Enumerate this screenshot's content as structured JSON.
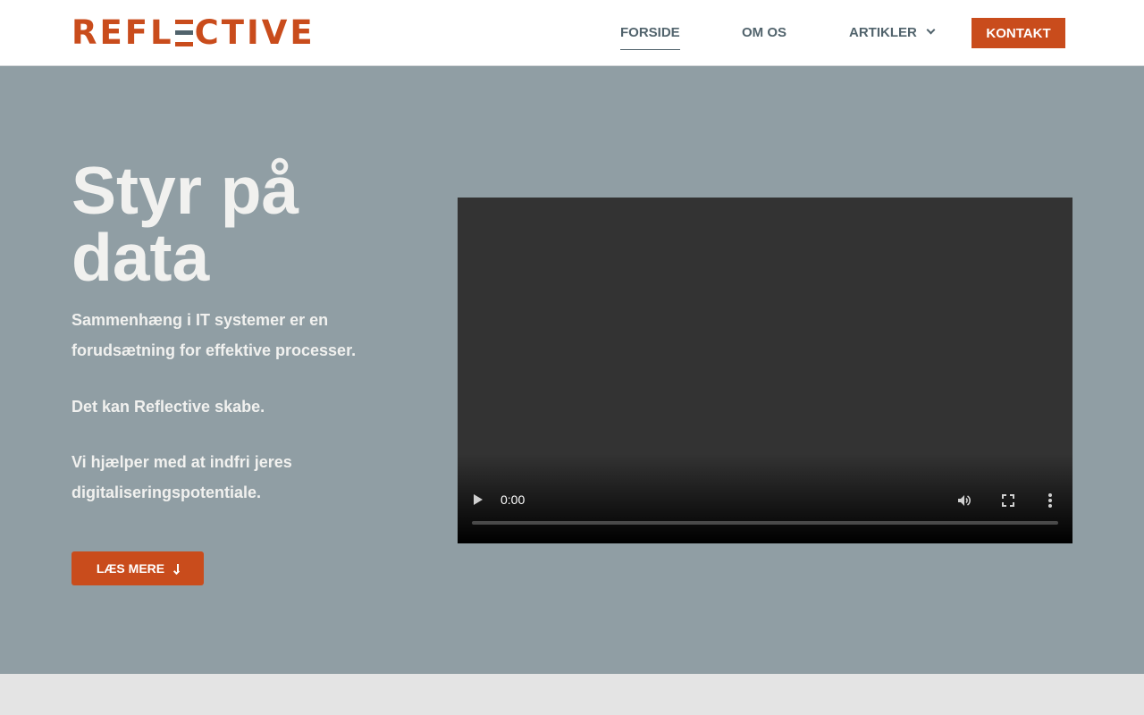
{
  "brand": {
    "logo_text_left": "REFL",
    "logo_text_right": "CTIVE",
    "color": "#c94c1c"
  },
  "nav": {
    "items": [
      {
        "label": "FORSIDE",
        "active": true
      },
      {
        "label": "OM OS",
        "active": false
      },
      {
        "label": "ARTIKLER",
        "active": false,
        "has_dropdown": true
      }
    ],
    "contact_label": "KONTAKT"
  },
  "hero": {
    "title": "Styr på data",
    "paragraphs": [
      "Sammenhæng i IT systemer er en forudsætning for effektive processer.",
      "Det kan Reflective skabe.",
      "Vi hjælper med at indfri jeres digitaliseringspotentiale."
    ],
    "button_label": "LÆS MERE",
    "background": "#909ea4"
  },
  "video": {
    "time": "0:00",
    "progress": 0,
    "icons": [
      "play-icon",
      "volume-icon",
      "fullscreen-icon",
      "more-options-icon"
    ]
  }
}
